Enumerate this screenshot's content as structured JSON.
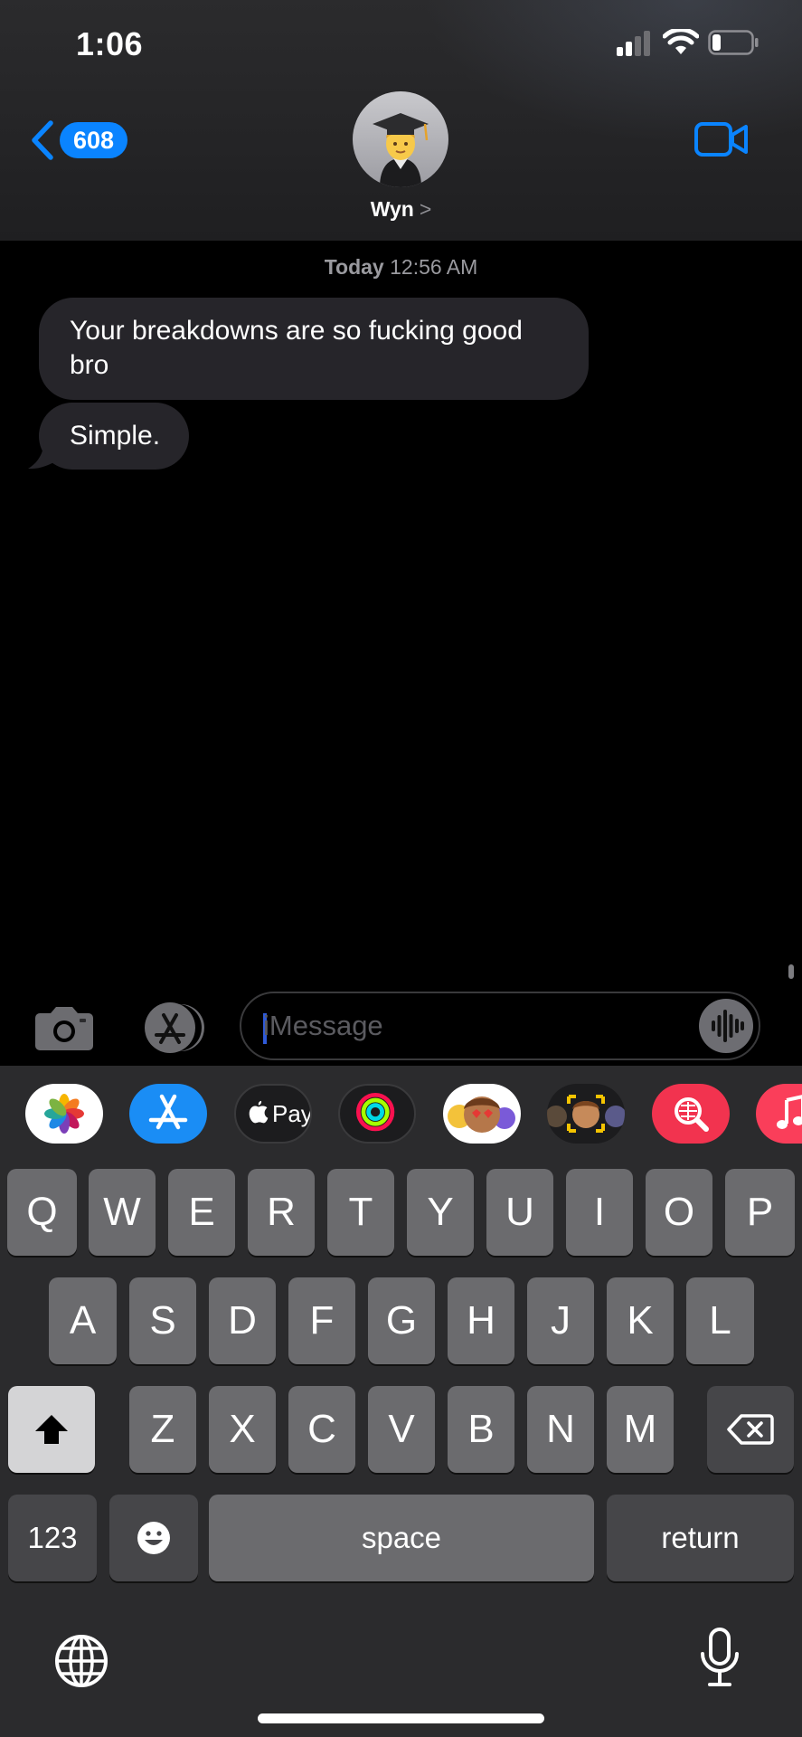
{
  "status_bar": {
    "time": "1:06",
    "signal_icon": "signal-bars-icon",
    "wifi_icon": "wifi-icon",
    "battery_icon": "battery-low-icon"
  },
  "header": {
    "back_count": "608",
    "contact_name": "Wyn",
    "contact_chevron": ">",
    "avatar_icon": "student-graduate-emoji",
    "video_icon": "video-camera-icon",
    "accent_color": "#0a84ff"
  },
  "conversation": {
    "timestamp_day": "Today",
    "timestamp_time": "12:56 AM",
    "messages": [
      {
        "direction": "incoming",
        "text": "Your breakdowns are so fucking good bro"
      },
      {
        "direction": "incoming",
        "text": "Simple."
      }
    ]
  },
  "composer": {
    "placeholder": "iMessage",
    "camera_icon": "camera-icon",
    "apps_icon": "app-store-icon",
    "audio_icon": "audio-waveform-icon"
  },
  "app_strip": [
    "photos-app-icon",
    "app-store-app-icon",
    "apple-pay-app-icon",
    "activity-app-icon",
    "memoji-stickers-app-icon",
    "memoji-camera-app-icon",
    "web-images-search-app-icon",
    "music-app-icon"
  ],
  "apple_pay_label": "Pay",
  "keyboard": {
    "row1": [
      "Q",
      "W",
      "E",
      "R",
      "T",
      "Y",
      "U",
      "I",
      "O",
      "P"
    ],
    "row2": [
      "A",
      "S",
      "D",
      "F",
      "G",
      "H",
      "J",
      "K",
      "L"
    ],
    "row3": [
      "Z",
      "X",
      "C",
      "V",
      "B",
      "N",
      "M"
    ],
    "numbers_label": "123",
    "space_label": "space",
    "return_label": "return",
    "shift_icon": "shift-icon",
    "delete_icon": "delete-backspace-icon",
    "emoji_icon": "emoji-face-icon",
    "globe_icon": "globe-icon",
    "mic_icon": "microphone-icon"
  }
}
